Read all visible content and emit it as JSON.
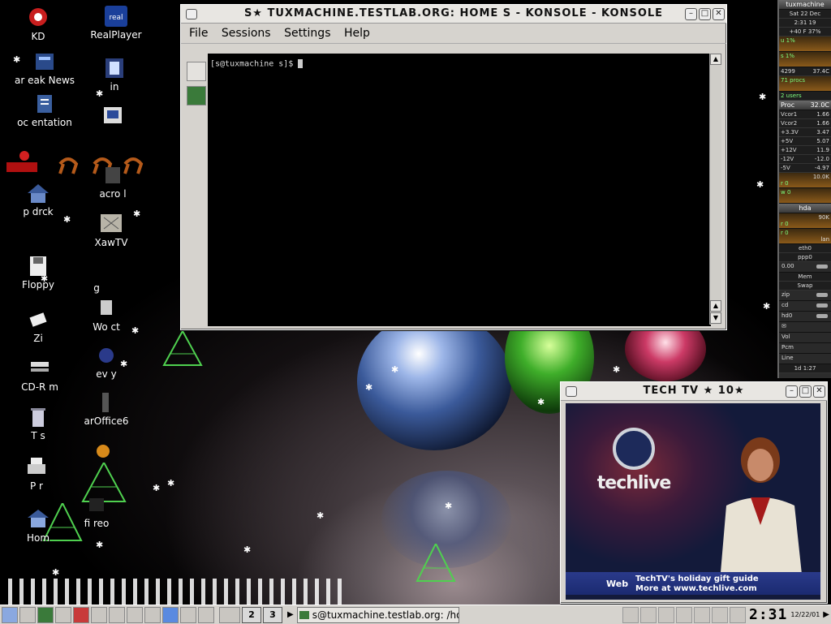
{
  "desktop_icons": [
    {
      "name": "kde-icon",
      "label": "KD"
    },
    {
      "name": "realplayer-icon",
      "label": "RealPlayer"
    },
    {
      "name": "news-icon",
      "label": "ar eak   News"
    },
    {
      "name": "app-icon",
      "label": "  in"
    },
    {
      "name": "documentation-icon",
      "label": "oc   entation"
    },
    {
      "name": "app2-icon",
      "label": ""
    },
    {
      "name": "home-icon",
      "label": "p  drck"
    },
    {
      "name": "acroread-icon",
      "label": "acro     l"
    },
    {
      "name": "xawtv-icon",
      "label": "XawTV"
    },
    {
      "name": "floppy-icon",
      "label": "Floppy"
    },
    {
      "name": "gimp-icon",
      "label": "g"
    },
    {
      "name": "zip-icon",
      "label": "Zi"
    },
    {
      "name": "word-icon",
      "label": "Wo      ct"
    },
    {
      "name": "cdrom-icon",
      "label": "CD-R m"
    },
    {
      "name": "everybuddy-icon",
      "label": "ev     y"
    },
    {
      "name": "trash-icon",
      "label": "T   s"
    },
    {
      "name": "staroffice-icon",
      "label": "  arOffice6"
    },
    {
      "name": "printer-icon",
      "label": "P      r"
    },
    {
      "name": "home2-icon",
      "label": "Hom"
    },
    {
      "name": "firefox-icon",
      "label": "fi    reo"
    }
  ],
  "konsole": {
    "title": "S★ TUXMACHINE.TESTLAB.ORG:   HOME   S - KONSOLE - KONSOLE",
    "menu": [
      "File",
      "Sessions",
      "Settings",
      "Help"
    ],
    "prompt": "[s@tuxmachine s]$"
  },
  "tv": {
    "title": "TECH TV ★  10★",
    "logo_text": "techlive",
    "crawl_label": "Web",
    "crawl_line1": "TechTV's holiday gift guide",
    "crawl_line2": "More at www.techlive.com"
  },
  "gkrellm": {
    "host": "tuxmachine",
    "date": "Sat 22 Dec",
    "time": "2:31  19",
    "temp": "+40 F  37%",
    "cpu0": "u 1%",
    "cpu1": "s 1%",
    "mem": "4299",
    "mem2": "37.4C",
    "procs": "71 procs",
    "users": "2 users",
    "proc_hdr": "Proc",
    "proc_temp": "32.0C",
    "sensors": [
      [
        "Vcor1",
        "1.66"
      ],
      [
        "Vcor2",
        "1.66"
      ],
      [
        "+3.3V",
        "3.47"
      ],
      [
        "+5V",
        "5.07"
      ],
      [
        "+12V",
        "11.9"
      ],
      [
        "-12V",
        "-12.0"
      ],
      [
        "-5V",
        "-4.97"
      ]
    ],
    "net_rate": "10.0K",
    "r0": "r 0",
    "w0": "w 0",
    "hda": "hda",
    "rate2": "90K",
    "lan": "lan",
    "eth0": "eth0",
    "ppp0": "ppp0",
    "load": "0.00",
    "mem_lbl": "Mem",
    "swap_lbl": "Swap",
    "zip": "zip",
    "cd": "cd",
    "hd0": "hd0",
    "vol": "Vol",
    "pcm": "Pcm",
    "line": "Line",
    "uptime": "1d 1:27"
  },
  "taskbar": {
    "pager": [
      "2",
      "3"
    ],
    "task": "s@tuxmachine.testlab.org: /ho",
    "clock": "2:31",
    "date": "12/22/01"
  }
}
